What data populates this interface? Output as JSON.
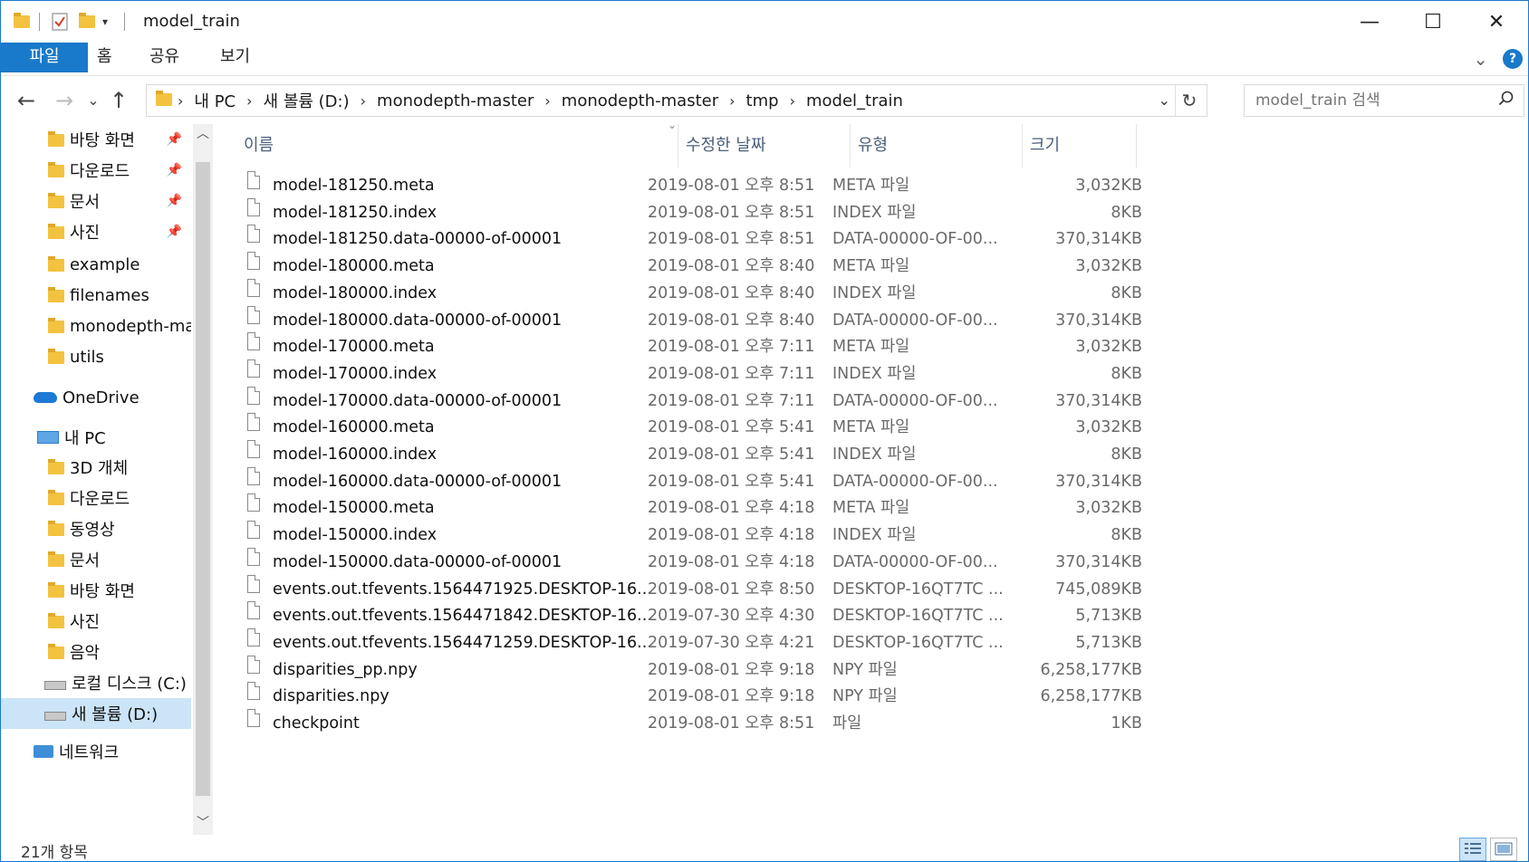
{
  "window": {
    "title": "model_train",
    "minimize": "—",
    "maximize": "☐",
    "close": "✕"
  },
  "ribbon": {
    "tabs": [
      "파일",
      "홈",
      "공유",
      "보기"
    ],
    "expand_icon": "⌄",
    "help": "?"
  },
  "nav": {
    "back": "←",
    "forward": "→",
    "recent": "⌄",
    "up": "↑",
    "breadcrumbs": [
      "내 PC",
      "새 볼륨 (D:)",
      "monodepth-master",
      "monodepth-master",
      "tmp",
      "model_train"
    ],
    "refresh": "↻",
    "dropdown": "⌄"
  },
  "search": {
    "placeholder": "model_train 검색",
    "icon": "🔍"
  },
  "sidebar": {
    "items": [
      {
        "label": "바탕 화면",
        "icon": "folder-icon",
        "pinned": true
      },
      {
        "label": "다운로드",
        "icon": "download-folder-icon",
        "pinned": true
      },
      {
        "label": "문서",
        "icon": "documents-folder-icon",
        "pinned": true
      },
      {
        "label": "사진",
        "icon": "pictures-folder-icon",
        "pinned": true
      },
      {
        "label": "example",
        "icon": "folder-icon",
        "pinned": false
      },
      {
        "label": "filenames",
        "icon": "folder-icon",
        "pinned": false
      },
      {
        "label": "monodepth-master",
        "icon": "folder-icon",
        "pinned": false
      },
      {
        "label": "utils",
        "icon": "folder-icon",
        "pinned": false
      },
      {
        "label": "OneDrive",
        "icon": "onedrive-icon",
        "pinned": false
      },
      {
        "label": "내 PC",
        "icon": "pc-icon",
        "pinned": false
      },
      {
        "label": "3D 개체",
        "icon": "3d-objects-icon",
        "pinned": false
      },
      {
        "label": "다운로드",
        "icon": "download-folder-icon",
        "pinned": false
      },
      {
        "label": "동영상",
        "icon": "video-folder-icon",
        "pinned": false
      },
      {
        "label": "문서",
        "icon": "documents-folder-icon",
        "pinned": false
      },
      {
        "label": "바탕 화면",
        "icon": "desktop-folder-icon",
        "pinned": false
      },
      {
        "label": "사진",
        "icon": "pictures-folder-icon",
        "pinned": false
      },
      {
        "label": "음악",
        "icon": "music-folder-icon",
        "pinned": false
      },
      {
        "label": "로컬 디스크 (C:)",
        "icon": "drive-icon",
        "pinned": false
      },
      {
        "label": "새 볼륨 (D:)",
        "icon": "drive-icon",
        "pinned": false,
        "selected": true
      },
      {
        "label": "네트워크",
        "icon": "network-icon",
        "pinned": false
      }
    ],
    "pin_glyph": "📌"
  },
  "columns": {
    "name": "이름",
    "date": "수정한 날짜",
    "type": "유형",
    "size": "크기"
  },
  "files": [
    {
      "name": "model-181250.meta",
      "date": "2019-08-01 오후 8:51",
      "type": "META 파일",
      "size": "3,032KB"
    },
    {
      "name": "model-181250.index",
      "date": "2019-08-01 오후 8:51",
      "type": "INDEX 파일",
      "size": "8KB"
    },
    {
      "name": "model-181250.data-00000-of-00001",
      "date": "2019-08-01 오후 8:51",
      "type": "DATA-00000-OF-00...",
      "size": "370,314KB"
    },
    {
      "name": "model-180000.meta",
      "date": "2019-08-01 오후 8:40",
      "type": "META 파일",
      "size": "3,032KB"
    },
    {
      "name": "model-180000.index",
      "date": "2019-08-01 오후 8:40",
      "type": "INDEX 파일",
      "size": "8KB"
    },
    {
      "name": "model-180000.data-00000-of-00001",
      "date": "2019-08-01 오후 8:40",
      "type": "DATA-00000-OF-00...",
      "size": "370,314KB"
    },
    {
      "name": "model-170000.meta",
      "date": "2019-08-01 오후 7:11",
      "type": "META 파일",
      "size": "3,032KB"
    },
    {
      "name": "model-170000.index",
      "date": "2019-08-01 오후 7:11",
      "type": "INDEX 파일",
      "size": "8KB"
    },
    {
      "name": "model-170000.data-00000-of-00001",
      "date": "2019-08-01 오후 7:11",
      "type": "DATA-00000-OF-00...",
      "size": "370,314KB"
    },
    {
      "name": "model-160000.meta",
      "date": "2019-08-01 오후 5:41",
      "type": "META 파일",
      "size": "3,032KB"
    },
    {
      "name": "model-160000.index",
      "date": "2019-08-01 오후 5:41",
      "type": "INDEX 파일",
      "size": "8KB"
    },
    {
      "name": "model-160000.data-00000-of-00001",
      "date": "2019-08-01 오후 5:41",
      "type": "DATA-00000-OF-00...",
      "size": "370,314KB"
    },
    {
      "name": "model-150000.meta",
      "date": "2019-08-01 오후 4:18",
      "type": "META 파일",
      "size": "3,032KB"
    },
    {
      "name": "model-150000.index",
      "date": "2019-08-01 오후 4:18",
      "type": "INDEX 파일",
      "size": "8KB"
    },
    {
      "name": "model-150000.data-00000-of-00001",
      "date": "2019-08-01 오후 4:18",
      "type": "DATA-00000-OF-00...",
      "size": "370,314KB"
    },
    {
      "name": "events.out.tfevents.1564471925.DESKTOP-16...",
      "date": "2019-08-01 오후 8:50",
      "type": "DESKTOP-16QT7TC ...",
      "size": "745,089KB"
    },
    {
      "name": "events.out.tfevents.1564471842.DESKTOP-16...",
      "date": "2019-07-30 오후 4:30",
      "type": "DESKTOP-16QT7TC ...",
      "size": "5,713KB"
    },
    {
      "name": "events.out.tfevents.1564471259.DESKTOP-16...",
      "date": "2019-07-30 오후 4:21",
      "type": "DESKTOP-16QT7TC ...",
      "size": "5,713KB"
    },
    {
      "name": "disparities_pp.npy",
      "date": "2019-08-01 오후 9:18",
      "type": "NPY 파일",
      "size": "6,258,177KB"
    },
    {
      "name": "disparities.npy",
      "date": "2019-08-01 오후 9:18",
      "type": "NPY 파일",
      "size": "6,258,177KB"
    },
    {
      "name": "checkpoint",
      "date": "2019-08-01 오후 8:51",
      "type": "파일",
      "size": "1KB"
    }
  ],
  "status": {
    "item_count": "21개 항목"
  },
  "colors": {
    "accent": "#1979ca",
    "selection": "#cce4f7"
  }
}
